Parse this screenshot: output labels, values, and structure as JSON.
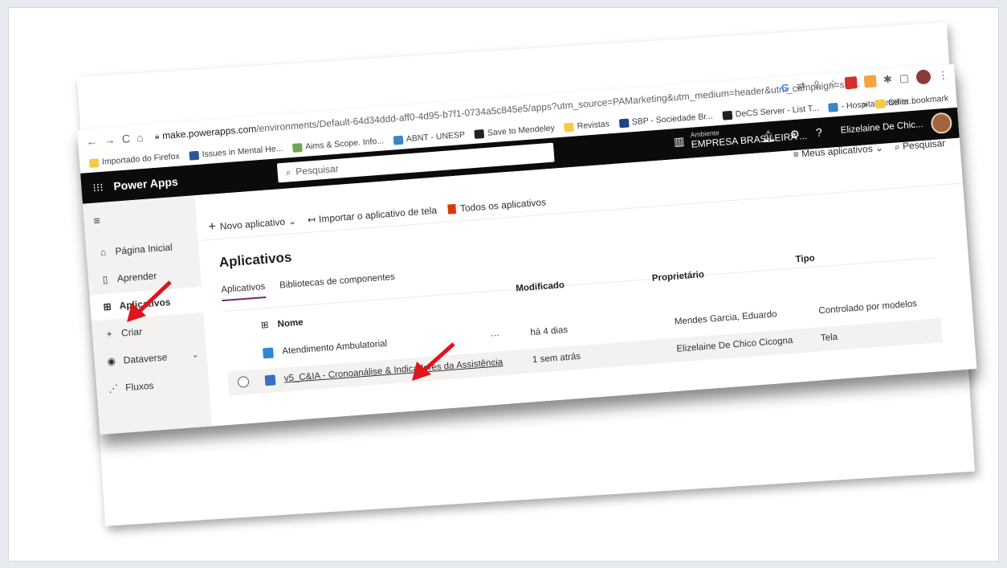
{
  "browser": {
    "url_host": "make.powerapps.com",
    "url_path": "/environments/Default-64d34ddd-aff0-4d95-b7f1-0734a5c845e5/apps?utm_source=PAMarketing&utm_medium=header&utm_campaign=sig...",
    "bookmarks": [
      {
        "label": "Importado do Firefox",
        "color": "#f7c948"
      },
      {
        "label": "Issues in Mental He...",
        "color": "#2b5797"
      },
      {
        "label": "Aims & Scope. Info...",
        "color": "#6aa84f"
      },
      {
        "label": "ABNT - UNESP",
        "color": "#3d85c6"
      },
      {
        "label": "Save to Mendeley",
        "color": "#202124"
      },
      {
        "label": "Revistas",
        "color": "#f7c948"
      },
      {
        "label": "SBP - Sociedade Br...",
        "color": "#1c4587"
      },
      {
        "label": "DeCS Server - List T...",
        "color": "#202124"
      },
      {
        "label": "- Hospital Israelita...",
        "color": "#3d85c6"
      }
    ],
    "other_bookmarks": "Other bookmark",
    "more_bookmarks": "»"
  },
  "header": {
    "app_title": "Power Apps",
    "search_placeholder": "Pesquisar",
    "env_label": "Ambiente",
    "env_name": "EMPRESA BRASILEIRA ...",
    "user_name": "Elizelaine De Chic..."
  },
  "sidebar": {
    "items": [
      {
        "label": "Página Inicial",
        "icon": "home-icon"
      },
      {
        "label": "Aprender",
        "icon": "book-icon"
      },
      {
        "label": "Aplicativos",
        "icon": "apps-icon"
      },
      {
        "label": "Criar",
        "icon": "plus-icon"
      },
      {
        "label": "Dataverse",
        "icon": "dataverse-icon"
      },
      {
        "label": "Fluxos",
        "icon": "flow-icon"
      }
    ]
  },
  "main": {
    "my_apps_filter": "Meus aplicativos",
    "search_label": "Pesquisar",
    "commands": {
      "new_app": "Novo aplicativo",
      "import_canvas": "Importar o aplicativo de tela",
      "all_apps": "Todos os aplicativos"
    },
    "heading": "Aplicativos",
    "tabs": [
      "Aplicativos",
      "Bibliotecas de componentes"
    ],
    "columns": {
      "name": "Nome",
      "modified": "Modificado",
      "owner": "Proprietário",
      "type": "Tipo"
    },
    "rows": [
      {
        "name": "Atendimento Ambulatorial",
        "dots": "···",
        "modified": "há 4 dias",
        "owner": "Mendes Garcia, Eduardo",
        "type": "Controlado por modelos",
        "icon_color": "#2e86d6"
      },
      {
        "name": "v5_C&IA - Cronoanálise & Indicadores da Assistência",
        "dots": "···",
        "modified": "1 sem atrás",
        "owner": "Elizelaine De Chico Cicogna",
        "type": "Tela",
        "icon_color": "#3a6fc4"
      }
    ]
  },
  "colors": {
    "accent": "#742774",
    "header_bg": "#0b0b0b",
    "annotation_arrow": "#e0141e"
  }
}
